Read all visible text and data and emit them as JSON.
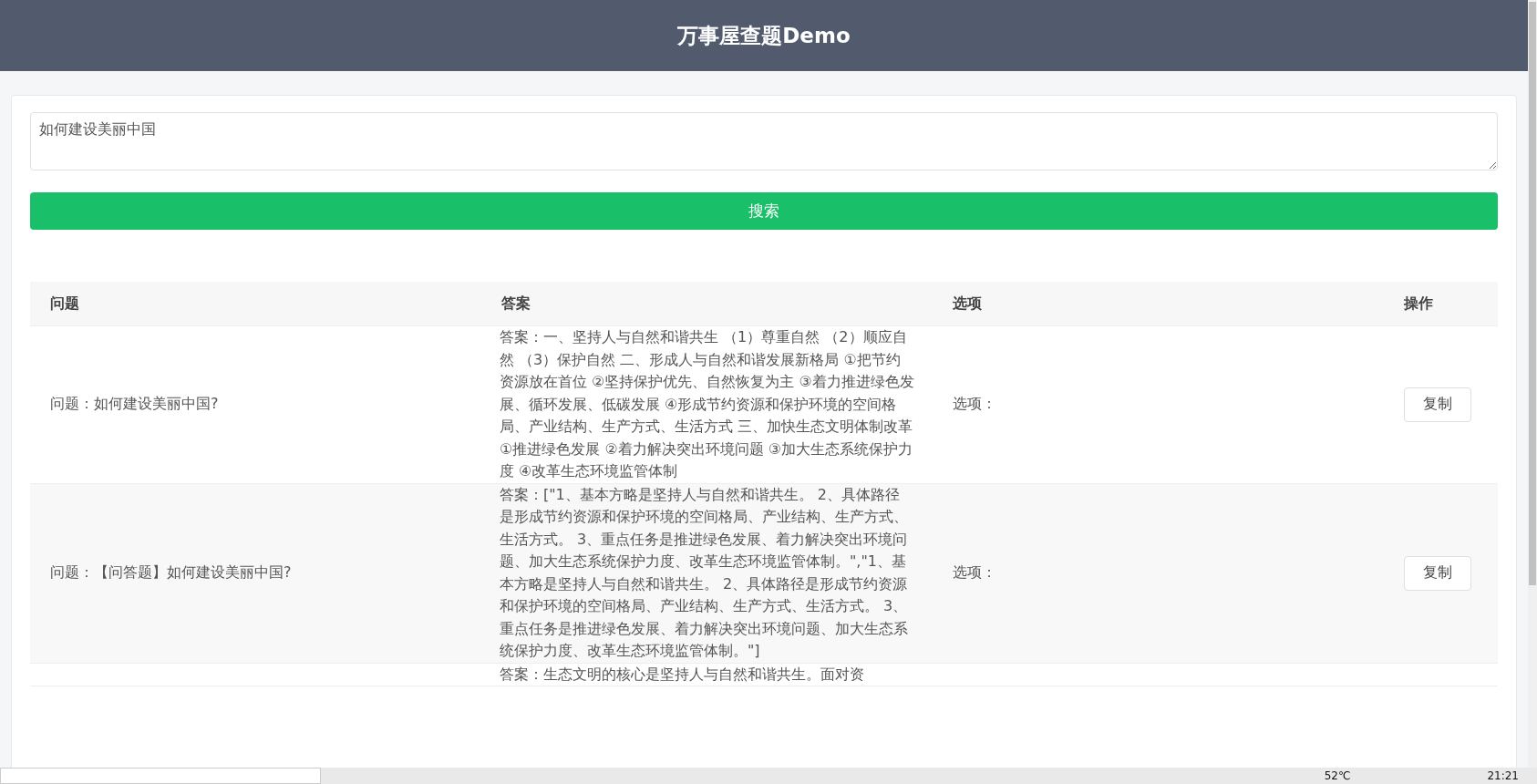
{
  "header": {
    "title": "万事屋查题Demo"
  },
  "search": {
    "value": "如何建设美丽中国",
    "button": "搜索"
  },
  "table": {
    "columns": [
      "问题",
      "答案",
      "选项",
      "操作"
    ],
    "rows": [
      {
        "question": "问题：如何建设美丽中国?",
        "answer": "答案：一、坚持人与自然和谐共生 （1）尊重自然 （2）顺应自然 （3）保护自然 二、形成人与自然和谐发展新格局 ①把节约资源放在首位 ②坚持保护优先、自然恢复为主 ③着力推进绿色发展、循环发展、低碳发展 ④形成节约资源和保护环境的空间格局、产业结构、生产方式、生活方式 三、加快生态文明体制改革 ①推进绿色发展 ②着力解决突出环境问题 ③加大生态系统保护力度 ④改革生态环境监管体制",
        "options": "选项：",
        "action": "复制"
      },
      {
        "question": "问题：【问答题】如何建设美丽中国?",
        "answer": "答案：[\"1、基本方略是坚持人与自然和谐共生。 2、具体路径是形成节约资源和保护环境的空间格局、产业结构、生产方式、生活方式。 3、重点任务是推进绿色发展、着力解决突出环境问题、加大生态系统保护力度、改革生态环境监管体制。\",\"1、基本方略是坚持人与自然和谐共生。 2、具体路径是形成节约资源和保护环境的空间格局、产业结构、生产方式、生活方式。 3、重点任务是推进绿色发展、着力解决突出环境问题、加大生态系统保护力度、改革生态环境监管体制。\"]",
        "options": "选项：",
        "action": "复制"
      },
      {
        "answer": "答案：生态文明的核心是坚持人与自然和谐共生。面对资"
      }
    ]
  },
  "taskbar": {
    "temperature": "52℃",
    "time": "21:21"
  }
}
